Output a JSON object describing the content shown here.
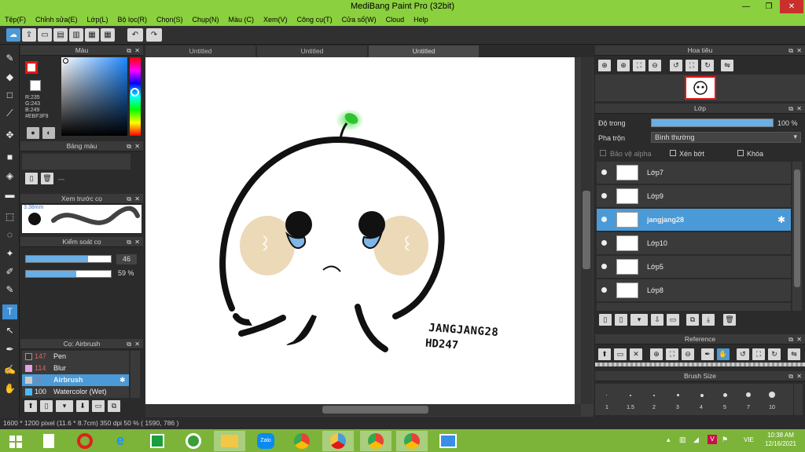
{
  "window": {
    "title": "MediBang Paint Pro (32bit)"
  },
  "menu": [
    "Tệp(F)",
    "Chỉnh sửa(E)",
    "Lớp(L)",
    "Bộ lọc(R)",
    "Chọn(S)",
    "Chụp(N)",
    "Màu (C)",
    "Xem(V)",
    "Công cụ(T)",
    "Cửa sổ(W)",
    "Cloud",
    "Help"
  ],
  "color_panel": {
    "title": "Màu",
    "r": "R:235",
    "g": "G:243",
    "b": "B:249",
    "hex": "#EBF3F9"
  },
  "palette_panel": {
    "title": "Bảng màu",
    "placeholder": "---"
  },
  "brush_preview": {
    "title": "Xem trước cọ",
    "size": "3.38mm"
  },
  "brush_control": {
    "title": "Kiểm soát cọ",
    "size_value": "46",
    "size_fraction": 0.73,
    "opacity_label": "59 %",
    "opacity_fraction": 0.59
  },
  "brush_list": {
    "title": "Cọ: Airbrush",
    "items": [
      {
        "num": "147",
        "name": "Pen",
        "color": "#333333"
      },
      {
        "num": "114",
        "name": "Blur",
        "color": "#e6a0e6"
      },
      {
        "num": "46",
        "name": "Airbrush",
        "color": "#cccccc",
        "selected": true
      },
      {
        "num": "100",
        "name": "Watercolor (Wet)",
        "color": "#4db8ff"
      }
    ]
  },
  "tabs": [
    "Untitled",
    "Untitled",
    "Untitled"
  ],
  "active_tab": 2,
  "canvas": {
    "watermark_line1": "JANGJANG28",
    "watermark_line2": "HD247"
  },
  "status": {
    "text": "1600 * 1200 pixel   (11.6 * 8.7cm)   350 dpi   50 %   ( 1590, 786 )"
  },
  "navigator": {
    "title": "Hoa tiêu"
  },
  "layer_panel": {
    "title": "Lớp",
    "opacity_label": "Độ trong",
    "opacity_value": "100 %",
    "opacity_fraction": 1.0,
    "blend_label": "Pha trộn",
    "blend_value": "Bình thường",
    "protect_alpha": "Bảo vệ alpha",
    "clipping": "Xén bớt",
    "lock": "Khóa",
    "layers": [
      "Lớp7",
      "Lớp9",
      "jangjang28",
      "Lớp10",
      "Lớp5",
      "Lớp8"
    ],
    "selected_index": 2
  },
  "reference_panel": {
    "title": "Reference"
  },
  "brush_size_panel": {
    "title": "Brush Size",
    "sizes": [
      "1",
      "1.5",
      "2",
      "3",
      "4",
      "5",
      "7",
      "10"
    ]
  },
  "taskbar": {
    "lang": "VIE",
    "time": "10:38 AM",
    "date": "12/16/2021"
  },
  "colors": {
    "title_green": "#8bd03e",
    "accent_blue": "#4a9ad7",
    "primary_color": "#e01818"
  }
}
